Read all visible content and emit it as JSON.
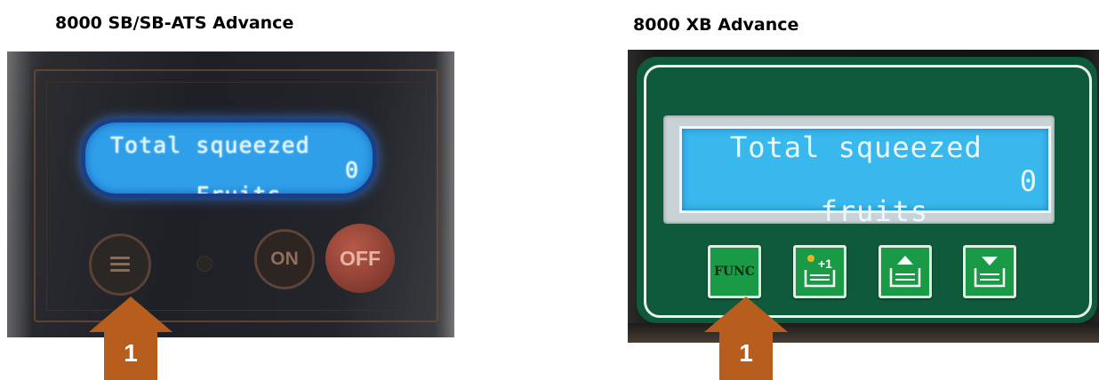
{
  "left_panel": {
    "caption": "8000 SB/SB-ATS Advance",
    "lcd": {
      "line1": "Total squeezed",
      "line2_label": "Fruits",
      "line2_value": "0"
    },
    "buttons": {
      "menu_icon": "menu-bars-icon",
      "on_label": "ON",
      "off_label": "OFF"
    },
    "callout_number": "1"
  },
  "right_panel": {
    "caption": "8000 XB Advance",
    "lcd": {
      "line1": "Total squeezed",
      "line2_label": "fruits",
      "line2_value": "0"
    },
    "keys": {
      "func_label": "FUNC",
      "plus1_label": "+1",
      "plus1_icon": "basket-plus-one-icon",
      "up_icon": "basket-up-icon",
      "down_icon": "basket-down-icon"
    },
    "callout_number": "1"
  },
  "colors": {
    "arrow": "#b75e1e",
    "lcd_left": "#2f9fe9",
    "lcd_right": "#39b8ee",
    "panel_green": "#0f5a3a",
    "key_green": "#1a9a47"
  }
}
